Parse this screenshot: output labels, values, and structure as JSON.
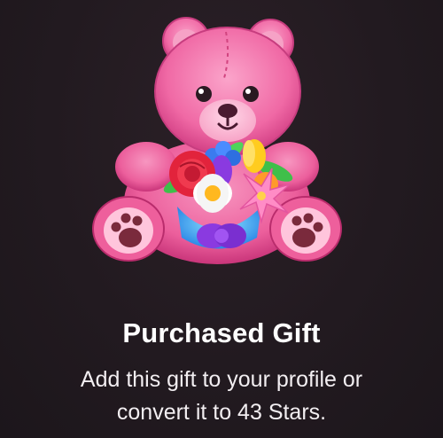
{
  "gift": {
    "illustration_icon": "teddy-bear-with-bouquet-icon",
    "title": "Purchased Gift",
    "description_line1": "Add this gift to your profile or",
    "description_line2": "convert it to 43 Stars.",
    "stars_amount": 43
  },
  "colors": {
    "background": "#221a20",
    "bear_pink": "#f06aa3",
    "text": "#ffffff"
  }
}
